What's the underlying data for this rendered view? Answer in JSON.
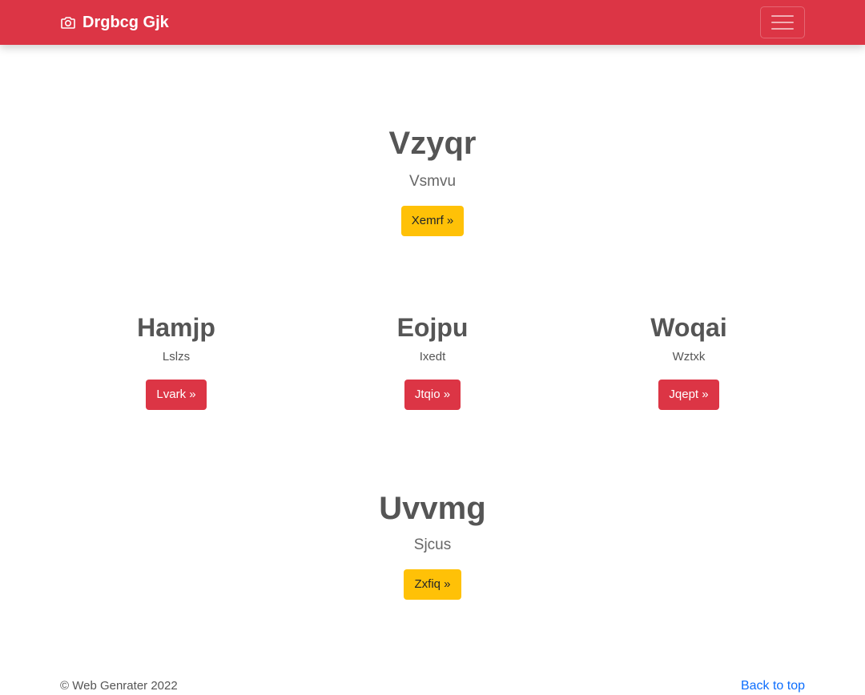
{
  "navbar": {
    "brand": "Drgbcg Gjk",
    "brand_icon": "camera-icon",
    "toggler_icon": "hamburger-menu-icon",
    "background": "#dc3545"
  },
  "hero_top": {
    "title": "Vzyqr",
    "subtitle": "Vsmvu",
    "button": "Xemrf »"
  },
  "columns": [
    {
      "title": "Hamjp",
      "text": "Lslzs",
      "button": "Lvark »"
    },
    {
      "title": "Eojpu",
      "text": "Ixedt",
      "button": "Jtqio »"
    },
    {
      "title": "Woqai",
      "text": "Wztxk",
      "button": "Jqept »"
    }
  ],
  "hero_bottom": {
    "title": "Uvvmg",
    "subtitle": "Sjcus",
    "button": "Zxfiq »"
  },
  "footer": {
    "copyright": "© Web Genrater 2022",
    "back_to_top": "Back to top"
  },
  "colors": {
    "primary_red": "#dc3545",
    "warning_yellow": "#ffc107",
    "link_blue": "#0d6efd"
  }
}
